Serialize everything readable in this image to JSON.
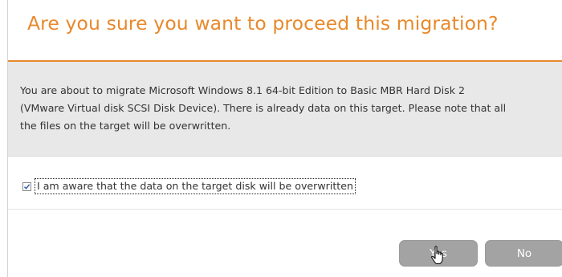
{
  "dialog": {
    "title": "Are you sure you want to proceed this migration?",
    "message_lines": [
      "You are about to migrate Microsoft Windows 8.1 64-bit Edition to Basic MBR Hard Disk 2",
      "(VMware Virtual disk SCSI Disk Device). There is already data on this target. Please note that all",
      "the files on the target will be overwritten."
    ],
    "confirm_checkbox": {
      "label": "I am aware that the data on the target disk will be overwritten",
      "checked": true
    },
    "buttons": {
      "yes_label": "Yes",
      "no_label": "No"
    },
    "colors": {
      "accent": "#e8892b",
      "panel_background": "#e8e8e8",
      "button_background": "#a3a3a3",
      "button_text": "#ffffff"
    },
    "cursor_icon": "hand-pointer-icon"
  }
}
